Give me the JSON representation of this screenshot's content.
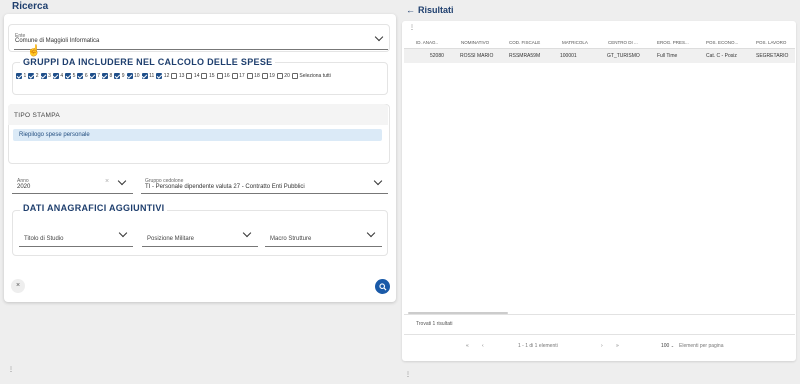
{
  "left": {
    "title": "Ricerca",
    "ente": {
      "label": "Ente",
      "value": "Comune di Maggioli Informatica"
    },
    "gruppi": {
      "title": "GRUPPI DA INCLUDERE NEL CALCOLO DELLE SPESE",
      "items": [
        {
          "label": "1",
          "checked": true
        },
        {
          "label": "2",
          "checked": true
        },
        {
          "label": "3",
          "checked": true
        },
        {
          "label": "4",
          "checked": true
        },
        {
          "label": "5",
          "checked": true
        },
        {
          "label": "6",
          "checked": true
        },
        {
          "label": "7",
          "checked": true
        },
        {
          "label": "8",
          "checked": true
        },
        {
          "label": "9",
          "checked": true
        },
        {
          "label": "10",
          "checked": true
        },
        {
          "label": "11",
          "checked": true
        },
        {
          "label": "12",
          "checked": true
        },
        {
          "label": "13",
          "checked": false
        },
        {
          "label": "14",
          "checked": false
        },
        {
          "label": "15",
          "checked": false
        },
        {
          "label": "16",
          "checked": false
        },
        {
          "label": "17",
          "checked": false
        },
        {
          "label": "18",
          "checked": false
        },
        {
          "label": "19",
          "checked": false
        },
        {
          "label": "20",
          "checked": false
        },
        {
          "label": "Seleziona tutti",
          "checked": false
        }
      ]
    },
    "tipo_stampa": {
      "title": "TIPO STAMPA",
      "selected": "Riepilogo spese personale"
    },
    "anno": {
      "label": "Anno",
      "value": "2020"
    },
    "gruppo_cedolone": {
      "label": "Gruppo cedolone",
      "value": "TI - Personale dipendente valuta 27 - Contratto Enti Pubblici"
    },
    "dati": {
      "title": "DATI ANAGRAFICI AGGIUNTIVI",
      "fields": [
        "Titolo di Studio",
        "Posizione Militare",
        "Macro Strutture"
      ]
    },
    "close_label": "×",
    "footer_dots": "⋮"
  },
  "right": {
    "title": "Risultati",
    "back_arrow": "←",
    "menu_dots": "⋮",
    "columns": [
      "ID. ANAG..",
      "NOMINATIVO",
      "COD. FISCALE",
      "MATRICOLA",
      "CENTRO DI ...",
      "EROG. PRES...",
      "POS. ECONO...",
      "POS. LAVORO"
    ],
    "rows": [
      [
        "52080",
        "ROSSI MARIO",
        "RSSMRA59M",
        "100001",
        "GT_TURISMO",
        "Full Time",
        "Cat. C - Posiz",
        "SEGRETARIO"
      ]
    ],
    "found_text": "Trovati 1 risultati",
    "pager": {
      "first": "«",
      "prev": "‹",
      "range": "1 - 1 di 1 elementi",
      "next": "›",
      "last": "»",
      "per_page_value": "100",
      "per_page_label": "Elementi per pagina"
    },
    "footer_dots": "⋮"
  },
  "colors": {
    "accent": "#1f3f6e",
    "primary_button": "#1a5aa8",
    "highlight": "#dbeaf7"
  }
}
